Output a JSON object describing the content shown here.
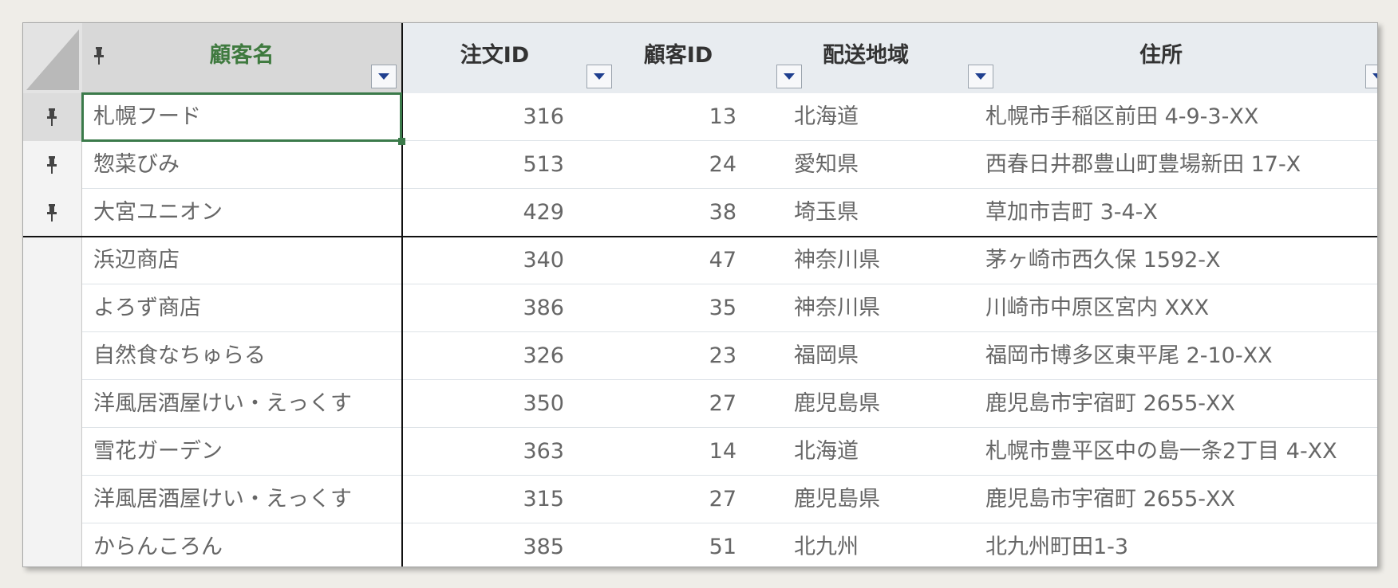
{
  "columns": {
    "name": "顧客名",
    "order_id": "注文ID",
    "customer_id": "顧客ID",
    "region": "配送地域",
    "address": "住所"
  },
  "rows": [
    {
      "name": "札幌フード",
      "order_id": "316",
      "customer_id": "13",
      "region": "北海道",
      "address": "札幌市手稲区前田 4-9-3-XX",
      "pinned": true
    },
    {
      "name": "惣菜びみ",
      "order_id": "513",
      "customer_id": "24",
      "region": "愛知県",
      "address": "西春日井郡豊山町豊場新田 17-X",
      "pinned": true
    },
    {
      "name": "大宮ユニオン",
      "order_id": "429",
      "customer_id": "38",
      "region": "埼玉県",
      "address": "草加市吉町 3-4-X",
      "pinned": true
    },
    {
      "name": "浜辺商店",
      "order_id": "340",
      "customer_id": "47",
      "region": "神奈川県",
      "address": "茅ヶ崎市西久保 1592-X",
      "pinned": false
    },
    {
      "name": "よろず商店",
      "order_id": "386",
      "customer_id": "35",
      "region": "神奈川県",
      "address": "川崎市中原区宮内 XXX",
      "pinned": false
    },
    {
      "name": "自然食なちゅらる",
      "order_id": "326",
      "customer_id": "23",
      "region": "福岡県",
      "address": "福岡市博多区東平尾 2-10-XX",
      "pinned": false
    },
    {
      "name": "洋風居酒屋けい・えっくす",
      "order_id": "350",
      "customer_id": "27",
      "region": "鹿児島県",
      "address": "鹿児島市宇宿町 2655-XX",
      "pinned": false
    },
    {
      "name": "雪花ガーデン",
      "order_id": "363",
      "customer_id": "14",
      "region": "北海道",
      "address": "札幌市豊平区中の島一条2丁目 4-XX",
      "pinned": false
    },
    {
      "name": "洋風居酒屋けい・えっくす",
      "order_id": "315",
      "customer_id": "27",
      "region": "鹿児島県",
      "address": "鹿児島市宇宿町 2655-XX",
      "pinned": false
    },
    {
      "name": "からんころん",
      "order_id": "385",
      "customer_id": "51",
      "region": "北九州",
      "address": "北九州町田1-3",
      "pinned": false
    }
  ],
  "colors": {
    "frozen_header_text": "#3f7a3f",
    "selection_border": "#3b7a4a",
    "filter_arrow": "#1f3f8f"
  },
  "icons": {
    "pin": "pin-icon",
    "filter": "filter-dropdown-icon"
  }
}
